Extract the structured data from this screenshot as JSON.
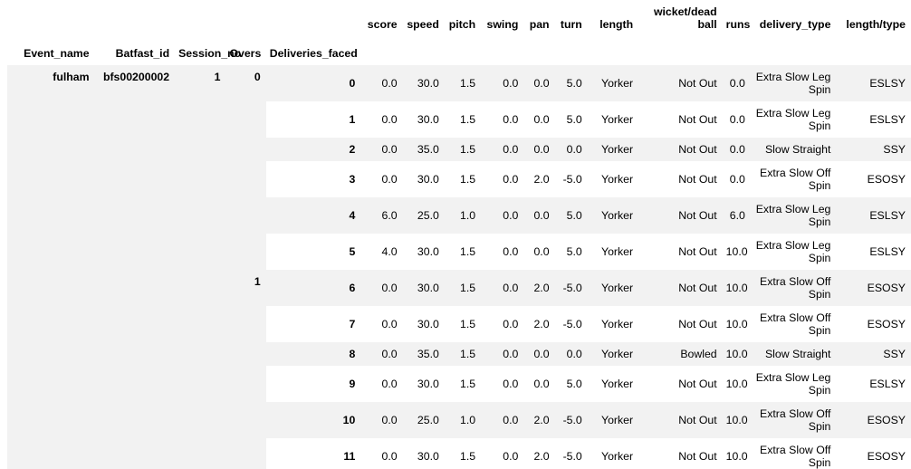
{
  "table": {
    "value_columns": [
      "score",
      "speed",
      "pitch",
      "swing",
      "pan",
      "turn",
      "length",
      "wicket/dead ball",
      "runs",
      "delivery_type",
      "length/type"
    ],
    "index_columns": [
      "Event_name",
      "Batfast_id",
      "Session_no",
      "Overs",
      "Deliveries_faced"
    ],
    "colors": {
      "stripe": "#f2f2f2",
      "background": "#ffffff",
      "rule": "#000000",
      "text": "#000000"
    },
    "index_values": {
      "event_name": "fulham",
      "batfast_id": "bfs00200002",
      "session_no": "1",
      "overs_first": "0",
      "overs_second": "1"
    },
    "rows": [
      {
        "deliveries_faced": "0",
        "overs": "0",
        "score": "0.0",
        "speed": "30.0",
        "pitch": "1.5",
        "swing": "0.0",
        "pan": "0.0",
        "turn": "5.0",
        "length": "Yorker",
        "wicket": "Not Out",
        "runs": "0.0",
        "delivery_type": "Extra Slow Leg Spin",
        "length_type": "ESLSY"
      },
      {
        "deliveries_faced": "1",
        "overs": "",
        "score": "0.0",
        "speed": "30.0",
        "pitch": "1.5",
        "swing": "0.0",
        "pan": "0.0",
        "turn": "5.0",
        "length": "Yorker",
        "wicket": "Not Out",
        "runs": "0.0",
        "delivery_type": "Extra Slow Leg Spin",
        "length_type": "ESLSY"
      },
      {
        "deliveries_faced": "2",
        "overs": "",
        "score": "0.0",
        "speed": "35.0",
        "pitch": "1.5",
        "swing": "0.0",
        "pan": "0.0",
        "turn": "0.0",
        "length": "Yorker",
        "wicket": "Not Out",
        "runs": "0.0",
        "delivery_type": "Slow Straight",
        "length_type": "SSY"
      },
      {
        "deliveries_faced": "3",
        "overs": "",
        "score": "0.0",
        "speed": "30.0",
        "pitch": "1.5",
        "swing": "0.0",
        "pan": "2.0",
        "turn": "-5.0",
        "length": "Yorker",
        "wicket": "Not Out",
        "runs": "0.0",
        "delivery_type": "Extra Slow Off Spin",
        "length_type": "ESOSY"
      },
      {
        "deliveries_faced": "4",
        "overs": "",
        "score": "6.0",
        "speed": "25.0",
        "pitch": "1.0",
        "swing": "0.0",
        "pan": "0.0",
        "turn": "5.0",
        "length": "Yorker",
        "wicket": "Not Out",
        "runs": "6.0",
        "delivery_type": "Extra Slow Leg Spin",
        "length_type": "ESLSY"
      },
      {
        "deliveries_faced": "5",
        "overs": "",
        "score": "4.0",
        "speed": "30.0",
        "pitch": "1.5",
        "swing": "0.0",
        "pan": "0.0",
        "turn": "5.0",
        "length": "Yorker",
        "wicket": "Not Out",
        "runs": "10.0",
        "delivery_type": "Extra Slow Leg Spin",
        "length_type": "ESLSY"
      },
      {
        "deliveries_faced": "6",
        "overs": "1",
        "score": "0.0",
        "speed": "30.0",
        "pitch": "1.5",
        "swing": "0.0",
        "pan": "2.0",
        "turn": "-5.0",
        "length": "Yorker",
        "wicket": "Not Out",
        "runs": "10.0",
        "delivery_type": "Extra Slow Off Spin",
        "length_type": "ESOSY"
      },
      {
        "deliveries_faced": "7",
        "overs": "",
        "score": "0.0",
        "speed": "30.0",
        "pitch": "1.5",
        "swing": "0.0",
        "pan": "2.0",
        "turn": "-5.0",
        "length": "Yorker",
        "wicket": "Not Out",
        "runs": "10.0",
        "delivery_type": "Extra Slow Off Spin",
        "length_type": "ESOSY"
      },
      {
        "deliveries_faced": "8",
        "overs": "",
        "score": "0.0",
        "speed": "35.0",
        "pitch": "1.5",
        "swing": "0.0",
        "pan": "0.0",
        "turn": "0.0",
        "length": "Yorker",
        "wicket": "Bowled",
        "runs": "10.0",
        "delivery_type": "Slow Straight",
        "length_type": "SSY"
      },
      {
        "deliveries_faced": "9",
        "overs": "",
        "score": "0.0",
        "speed": "30.0",
        "pitch": "1.5",
        "swing": "0.0",
        "pan": "0.0",
        "turn": "5.0",
        "length": "Yorker",
        "wicket": "Not Out",
        "runs": "10.0",
        "delivery_type": "Extra Slow Leg Spin",
        "length_type": "ESLSY"
      },
      {
        "deliveries_faced": "10",
        "overs": "",
        "score": "0.0",
        "speed": "25.0",
        "pitch": "1.0",
        "swing": "0.0",
        "pan": "2.0",
        "turn": "-5.0",
        "length": "Yorker",
        "wicket": "Not Out",
        "runs": "10.0",
        "delivery_type": "Extra Slow Off Spin",
        "length_type": "ESOSY"
      },
      {
        "deliveries_faced": "11",
        "overs": "",
        "score": "0.0",
        "speed": "30.0",
        "pitch": "1.5",
        "swing": "0.0",
        "pan": "2.0",
        "turn": "-5.0",
        "length": "Yorker",
        "wicket": "Not Out",
        "runs": "10.0",
        "delivery_type": "Extra Slow Off Spin",
        "length_type": "ESOSY"
      }
    ]
  }
}
